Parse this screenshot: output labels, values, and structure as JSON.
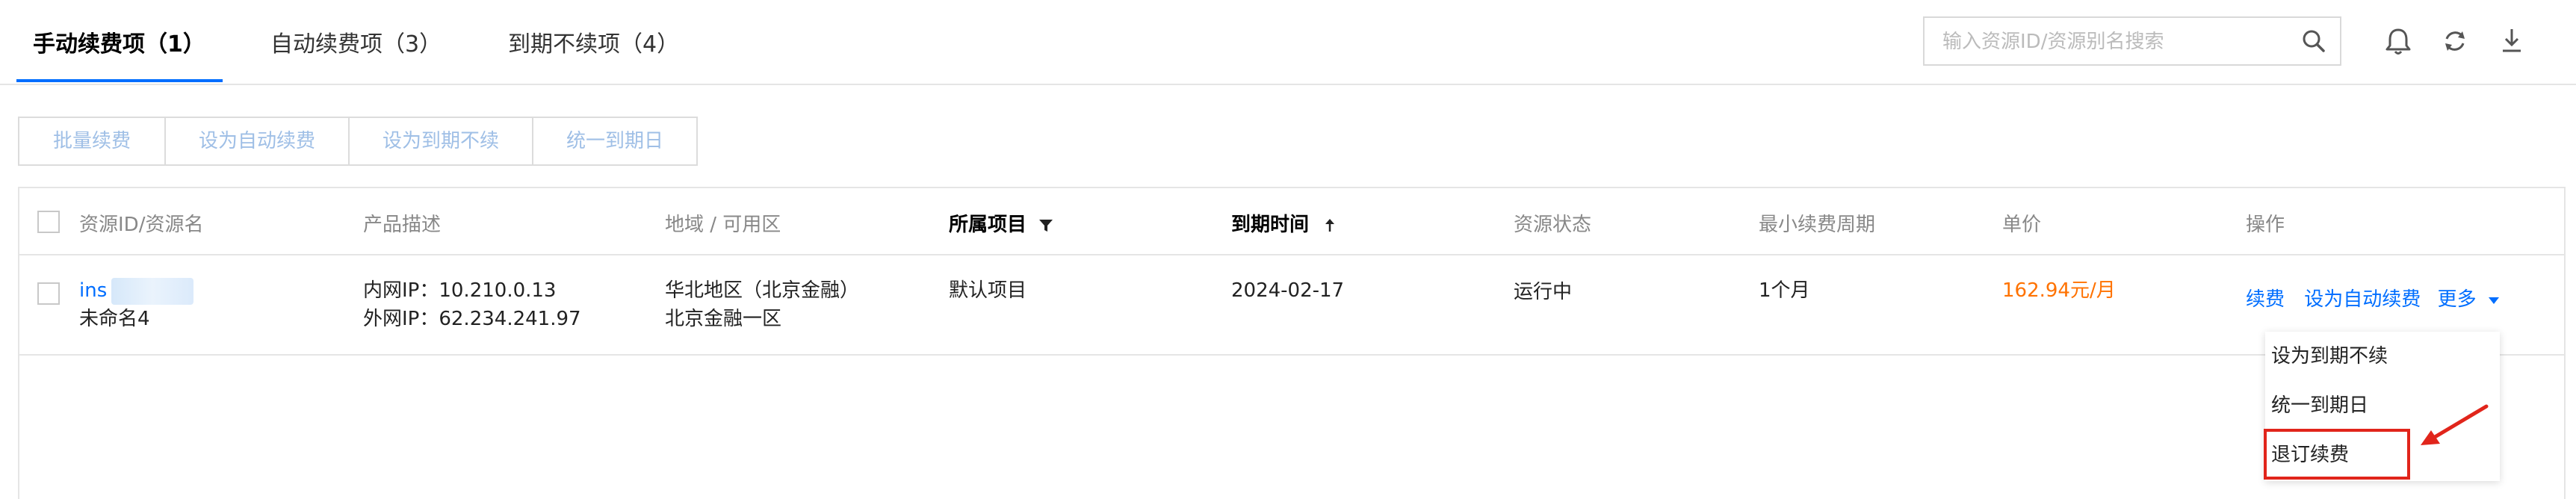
{
  "tabs": [
    {
      "label": "手动续费项（1）"
    },
    {
      "label": "自动续费项（3）"
    },
    {
      "label": "到期不续项（4）"
    }
  ],
  "search": {
    "placeholder": "输入资源ID/资源别名搜索"
  },
  "toolbar": [
    {
      "label": "批量续费"
    },
    {
      "label": "设为自动续费"
    },
    {
      "label": "设为到期不续"
    },
    {
      "label": "统一到期日"
    }
  ],
  "table": {
    "headers": {
      "resource": "资源ID/资源名",
      "product": "产品描述",
      "region": "地域 / 可用区",
      "project": "所属项目",
      "expiry": "到期时间",
      "status": "资源状态",
      "period": "最小续费周期",
      "price": "单价",
      "actions": "操作"
    },
    "rows": [
      {
        "resource_id": "ins",
        "resource_name": "未命名4",
        "private_ip": "内网IP：10.210.0.13",
        "public_ip": "外网IP：62.234.241.97",
        "region": "华北地区（北京金融）",
        "zone": "北京金融一区",
        "project": "默认项目",
        "expiry": "2024-02-17",
        "status": "运行中",
        "period": "1个月",
        "price": "162.94元/月",
        "action_renew": "续费",
        "action_auto": "设为自动续费",
        "action_more": "更多"
      }
    ]
  },
  "dropdown": [
    {
      "label": "设为到期不续"
    },
    {
      "label": "统一到期日"
    },
    {
      "label": "退订续费"
    }
  ],
  "colors": {
    "accent": "#006eff",
    "price": "#ff7200",
    "highlight": "#e1251b"
  }
}
